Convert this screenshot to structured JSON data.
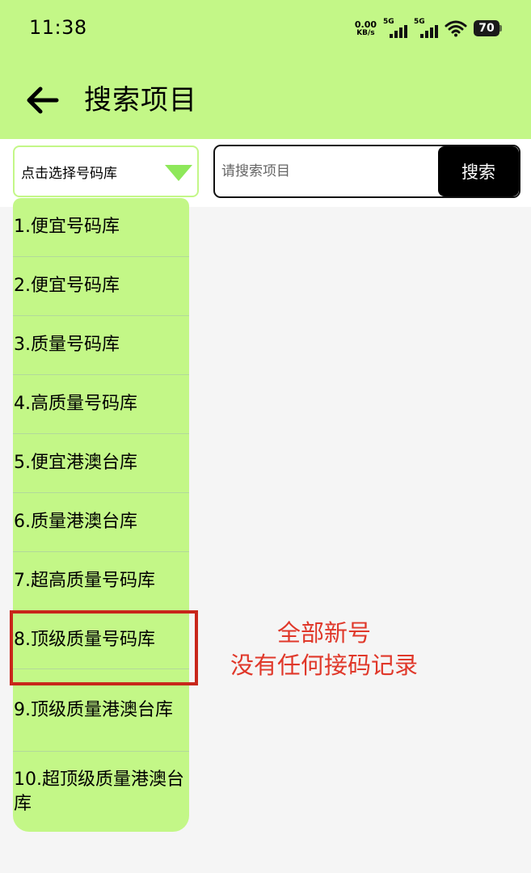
{
  "status_bar": {
    "time": "11:38",
    "net_speed_value": "0.00",
    "net_speed_unit": "KB/s",
    "signal1_label": "5G",
    "signal2_label": "5G",
    "battery_level": "70",
    "icons": [
      "signal-icon",
      "signal-icon",
      "wifi-icon",
      "battery-icon"
    ]
  },
  "app_bar": {
    "back_icon": "arrow-left-icon",
    "title": "搜索项目",
    "background_color": "#c3f787"
  },
  "controls": {
    "dropdown_label": "点击选择号码库",
    "dropdown_icon": "triangle-down-icon",
    "search_placeholder": "请搜索项目",
    "search_value": "",
    "search_button": "搜索"
  },
  "options": [
    "1.便宜号码库",
    "2.便宜号码库",
    "3.质量号码库",
    "4.高质量号码库",
    "5.便宜港澳台库",
    "6.质量港澳台库",
    "7.超高质量号码库",
    "8.顶级质量号码库",
    "9.顶级质量港澳台库",
    "10.超顶级质量港澳台库"
  ],
  "annotation": {
    "line1": "全部新号",
    "line2": "没有任何接码记录",
    "color": "#e0382a",
    "box_color": "#c8261b"
  }
}
